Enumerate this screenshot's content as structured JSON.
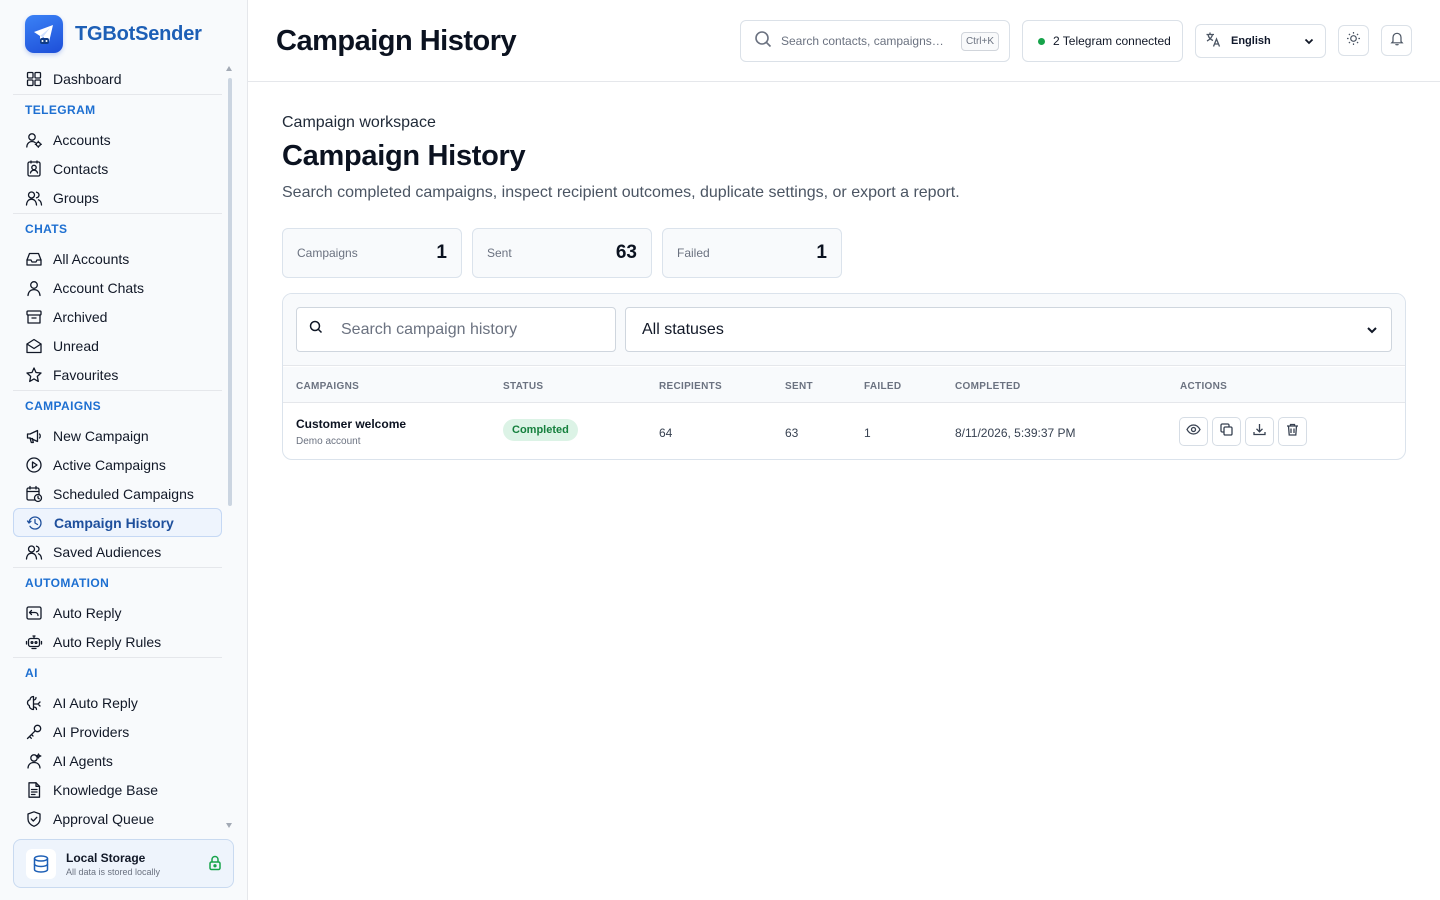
{
  "app": {
    "name": "TGBotSender"
  },
  "sidebar": {
    "items": [
      {
        "type": "item",
        "label": "Dashboard",
        "icon": "dashboard-icon",
        "active": false
      },
      {
        "type": "section",
        "label": "TELEGRAM"
      },
      {
        "type": "item",
        "label": "Accounts",
        "icon": "user-gear-icon",
        "active": false
      },
      {
        "type": "item",
        "label": "Contacts",
        "icon": "contact-book-icon",
        "active": false
      },
      {
        "type": "item",
        "label": "Groups",
        "icon": "users-icon",
        "active": false
      },
      {
        "type": "section",
        "label": "CHATS"
      },
      {
        "type": "item",
        "label": "All Accounts",
        "icon": "inbox-icon",
        "active": false
      },
      {
        "type": "item",
        "label": "Account Chats",
        "icon": "user-icon",
        "active": false
      },
      {
        "type": "item",
        "label": "Archived",
        "icon": "archive-icon",
        "active": false
      },
      {
        "type": "item",
        "label": "Unread",
        "icon": "mail-open-icon",
        "active": false
      },
      {
        "type": "item",
        "label": "Favourites",
        "icon": "star-icon",
        "active": false
      },
      {
        "type": "section",
        "label": "CAMPAIGNS"
      },
      {
        "type": "item",
        "label": "New Campaign",
        "icon": "megaphone-icon",
        "active": false
      },
      {
        "type": "item",
        "label": "Active Campaigns",
        "icon": "play-circle-icon",
        "active": false
      },
      {
        "type": "item",
        "label": "Scheduled Campaigns",
        "icon": "calendar-clock-icon",
        "active": false
      },
      {
        "type": "item",
        "label": "Campaign History",
        "icon": "history-icon",
        "active": true
      },
      {
        "type": "item",
        "label": "Saved Audiences",
        "icon": "users-icon",
        "active": false
      },
      {
        "type": "section",
        "label": "AUTOMATION"
      },
      {
        "type": "item",
        "label": "Auto Reply",
        "icon": "reply-icon",
        "active": false
      },
      {
        "type": "item",
        "label": "Auto Reply Rules",
        "icon": "bot-icon",
        "active": false
      },
      {
        "type": "section",
        "label": "AI"
      },
      {
        "type": "item",
        "label": "AI Auto Reply",
        "icon": "brain-icon",
        "active": false
      },
      {
        "type": "item",
        "label": "AI Providers",
        "icon": "key-icon",
        "active": false
      },
      {
        "type": "item",
        "label": "AI Agents",
        "icon": "agent-icon",
        "active": false
      },
      {
        "type": "item",
        "label": "Knowledge Base",
        "icon": "document-icon",
        "active": false
      },
      {
        "type": "item",
        "label": "Approval Queue",
        "icon": "shield-check-icon",
        "active": false
      }
    ],
    "storage": {
      "title": "Local Storage",
      "subtitle": "All data is stored locally"
    }
  },
  "header": {
    "title": "Campaign History",
    "search_placeholder": "Search contacts, campaigns, t...",
    "search_shortcut": "Ctrl+K",
    "telegram_status": "2 Telegram connected",
    "language": "English"
  },
  "page": {
    "eyebrow": "Campaign workspace",
    "title": "Campaign History",
    "description": "Search completed campaigns, inspect recipient outcomes, duplicate settings, or export a report."
  },
  "stats": [
    {
      "label": "Campaigns",
      "value": "1"
    },
    {
      "label": "Sent",
      "value": "63"
    },
    {
      "label": "Failed",
      "value": "1"
    }
  ],
  "filters": {
    "search_placeholder": "Search campaign history",
    "status_selected": "All statuses"
  },
  "table": {
    "columns": [
      "CAMPAIGNS",
      "STATUS",
      "RECIPIENTS",
      "SENT",
      "FAILED",
      "COMPLETED",
      "ACTIONS"
    ],
    "rows": [
      {
        "name": "Customer welcome",
        "account": "Demo account",
        "status": "Completed",
        "recipients": "64",
        "sent": "63",
        "failed": "1",
        "completed": "8/11/2026, 5:39:37 PM"
      }
    ]
  },
  "colors": {
    "brand": "#1d5fb6",
    "section": "#1d6fd1",
    "active_bg": "#eef4fd",
    "success": "#16a34a"
  }
}
